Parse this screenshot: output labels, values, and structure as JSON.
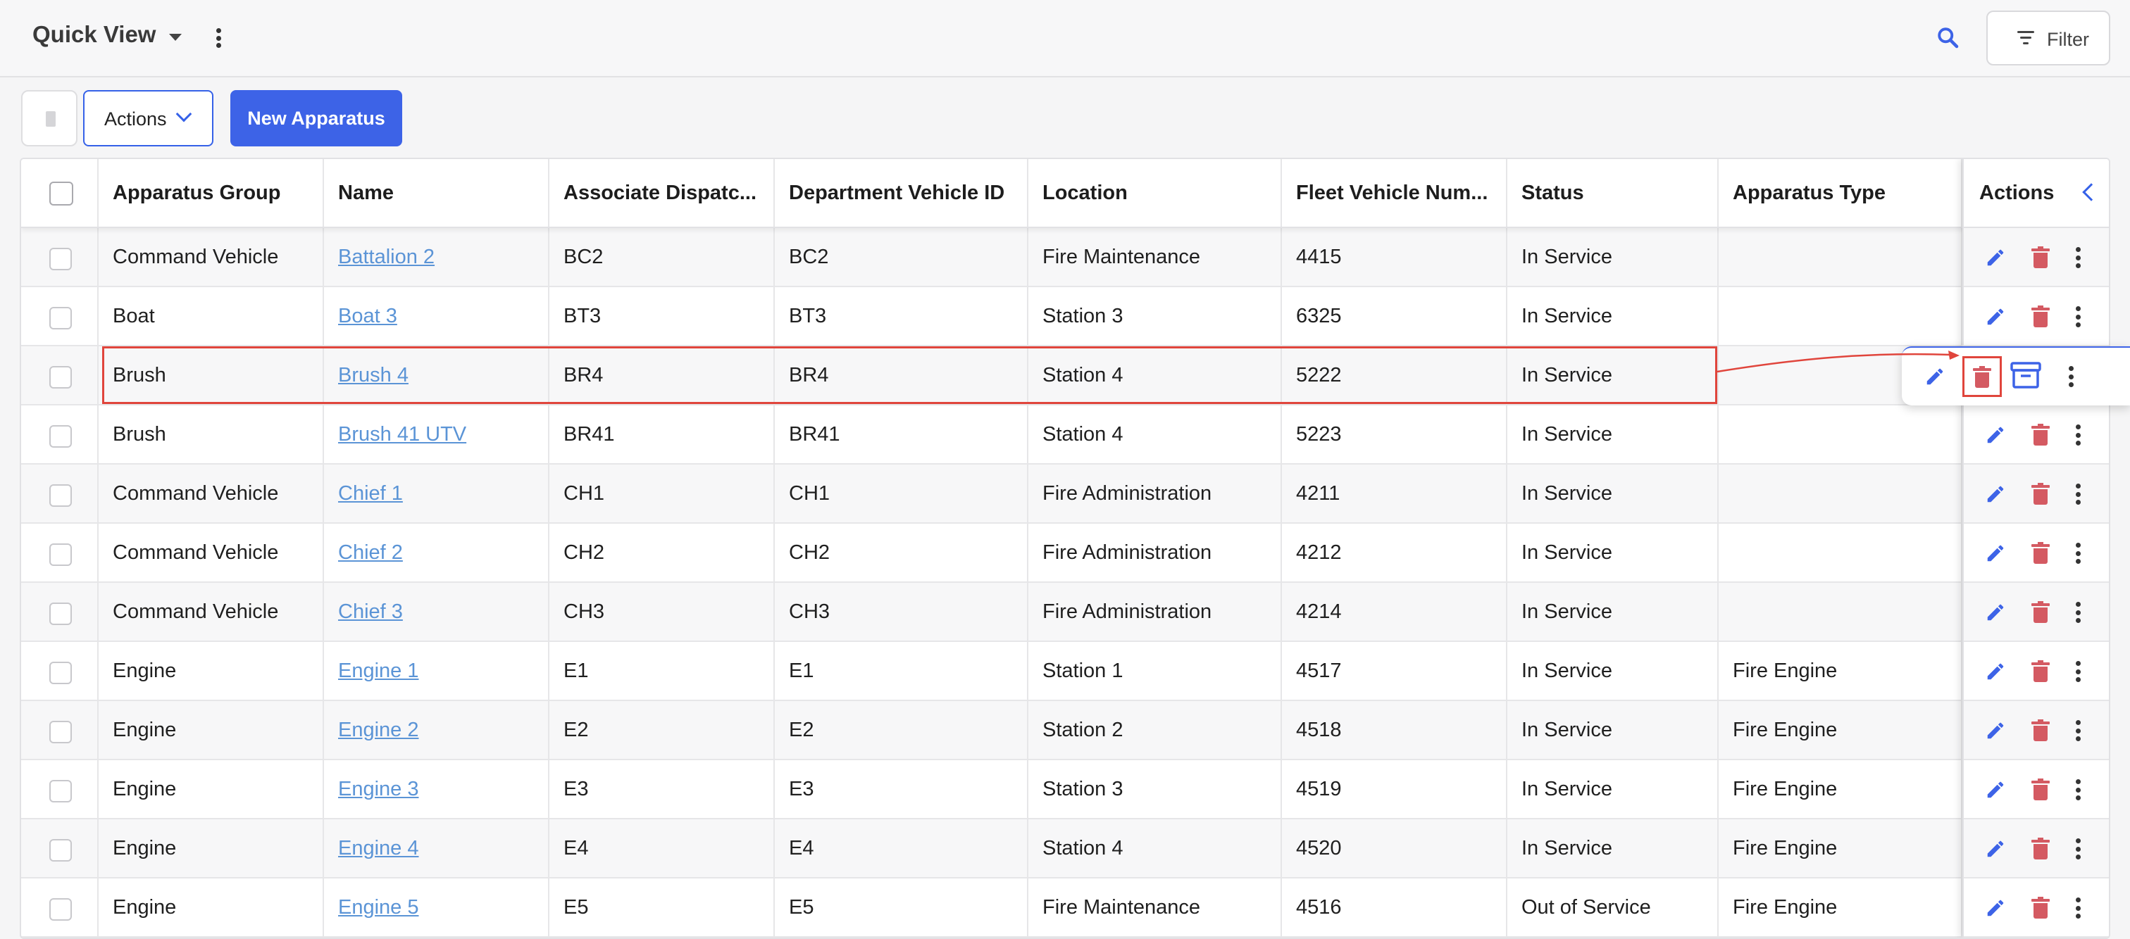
{
  "header": {
    "title": "Quick View",
    "filter_label": "Filter"
  },
  "toolbar": {
    "actions_label": "Actions",
    "new_label": "New Apparatus"
  },
  "table": {
    "columns": [
      "Apparatus Group",
      "Name",
      "Associate Dispatc...",
      "Department Vehicle ID",
      "Location",
      "Fleet Vehicle Num...",
      "Status",
      "Apparatus Type"
    ],
    "actions_header": "Actions",
    "rows": [
      {
        "group": "Command Vehicle",
        "name": "Battalion 2",
        "dispatch": "BC2",
        "dept_id": "BC2",
        "location": "Fire Maintenance",
        "fleet": "4415",
        "status": "In Service",
        "type": ""
      },
      {
        "group": "Boat",
        "name": "Boat 3",
        "dispatch": "BT3",
        "dept_id": "BT3",
        "location": "Station 3",
        "fleet": "6325",
        "status": "In Service",
        "type": ""
      },
      {
        "group": "Brush",
        "name": "Brush 4",
        "dispatch": "BR4",
        "dept_id": "BR4",
        "location": "Station 4",
        "fleet": "5222",
        "status": "In Service",
        "type": ""
      },
      {
        "group": "Brush",
        "name": "Brush 41 UTV",
        "dispatch": "BR41",
        "dept_id": "BR41",
        "location": "Station 4",
        "fleet": "5223",
        "status": "In Service",
        "type": ""
      },
      {
        "group": "Command Vehicle",
        "name": "Chief 1",
        "dispatch": "CH1",
        "dept_id": "CH1",
        "location": "Fire Administration",
        "fleet": "4211",
        "status": "In Service",
        "type": ""
      },
      {
        "group": "Command Vehicle",
        "name": "Chief 2",
        "dispatch": "CH2",
        "dept_id": "CH2",
        "location": "Fire Administration",
        "fleet": "4212",
        "status": "In Service",
        "type": ""
      },
      {
        "group": "Command Vehicle",
        "name": "Chief 3",
        "dispatch": "CH3",
        "dept_id": "CH3",
        "location": "Fire Administration",
        "fleet": "4214",
        "status": "In Service",
        "type": ""
      },
      {
        "group": "Engine",
        "name": "Engine 1",
        "dispatch": "E1",
        "dept_id": "E1",
        "location": "Station 1",
        "fleet": "4517",
        "status": "In Service",
        "type": "Fire Engine"
      },
      {
        "group": "Engine",
        "name": "Engine 2",
        "dispatch": "E2",
        "dept_id": "E2",
        "location": "Station 2",
        "fleet": "4518",
        "status": "In Service",
        "type": "Fire Engine"
      },
      {
        "group": "Engine",
        "name": "Engine 3",
        "dispatch": "E3",
        "dept_id": "E3",
        "location": "Station 3",
        "fleet": "4519",
        "status": "In Service",
        "type": "Fire Engine"
      },
      {
        "group": "Engine",
        "name": "Engine 4",
        "dispatch": "E4",
        "dept_id": "E4",
        "location": "Station 4",
        "fleet": "4520",
        "status": "In Service",
        "type": "Fire Engine"
      },
      {
        "group": "Engine",
        "name": "Engine 5",
        "dispatch": "E5",
        "dept_id": "E5",
        "location": "Fire Maintenance",
        "fleet": "4516",
        "status": "Out of Service",
        "type": "Fire Engine"
      }
    ]
  },
  "colors": {
    "accent": "#3d63e7",
    "link": "#5b94d6",
    "delete": "#d45a62",
    "highlight": "#e0453c"
  },
  "icons": [
    "chevron-down-icon",
    "more-vertical-icon",
    "search-icon",
    "filter-icon",
    "trash-icon",
    "edit-icon",
    "archive-icon",
    "chevron-left-icon"
  ]
}
